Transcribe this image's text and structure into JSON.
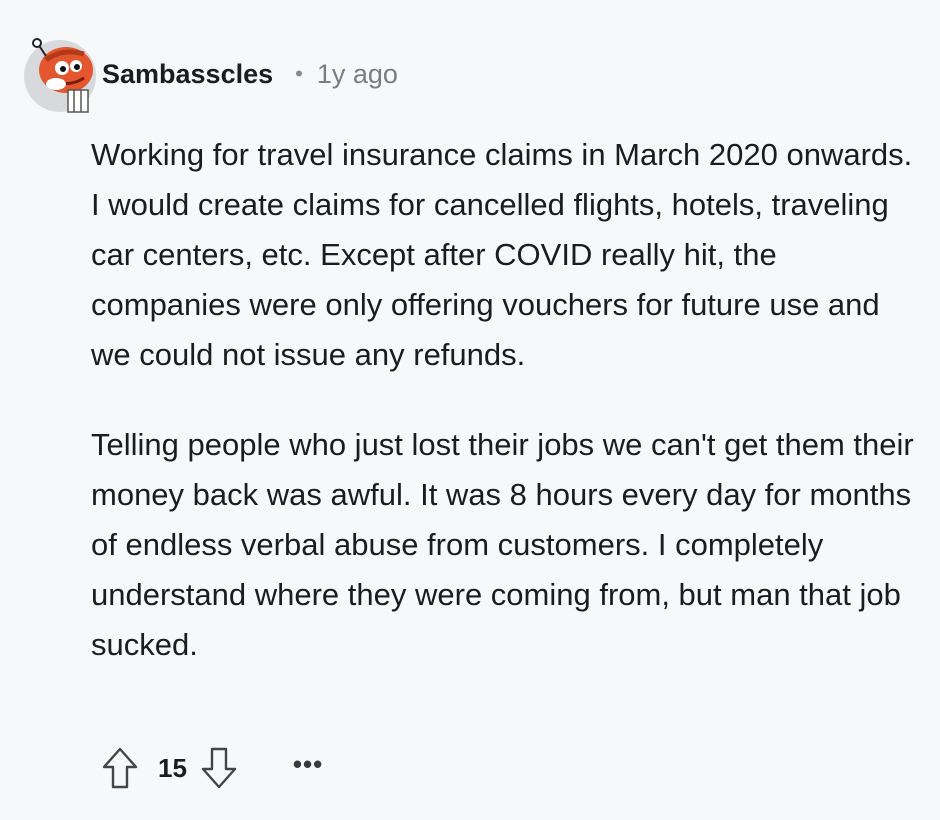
{
  "comment": {
    "username": "Sambasscles",
    "separator": "•",
    "time_ago": "1y ago",
    "paragraphs": [
      "Working for travel insurance claims in March 2020 onwards. I would create claims for cancelled flights, hotels, traveling car centers, etc. Except after COVID really hit, the companies were only offering vouchers for future use and we could not issue any refunds.",
      "Telling people who just lost their jobs we can't get them their money back was awful. It was 8 hours every day for months of endless verbal abuse from customers. I completely understand where they were coming from, but man that job sucked."
    ],
    "score": "15",
    "more_label": "•••"
  },
  "icons": {
    "avatar": "snoo-avatar-icon",
    "upvote": "upvote-arrow-icon",
    "downvote": "downvote-arrow-icon",
    "more": "more-options-icon"
  },
  "colors": {
    "background": "#f7f8fa",
    "text": "#1c1c1c",
    "muted": "#7c7c7c",
    "avatar_orange": "#e4572e"
  }
}
